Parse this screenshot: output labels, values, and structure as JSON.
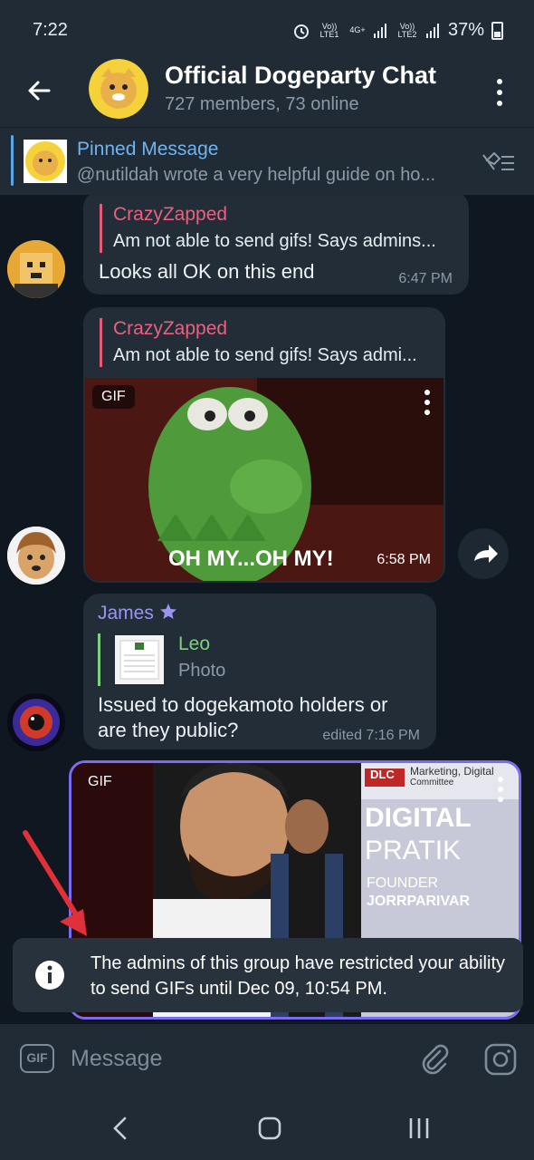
{
  "status": {
    "time": "7:22",
    "sim1": "Vo)) LTE1",
    "sim2": "Vo)) LTE2",
    "net": "4G+",
    "battery": "37%"
  },
  "header": {
    "title": "Official Dogeparty Chat",
    "subtitle": "727 members, 73 online"
  },
  "pinned": {
    "title": "Pinned Message",
    "text": "@nutildah wrote a very helpful guide on ho..."
  },
  "messages": [
    {
      "reply_name": "CrazyZapped",
      "reply_text": "Am not able to send gifs! Says admins...",
      "text": "Looks all OK on this end",
      "time": "6:47 PM"
    },
    {
      "reply_name": "CrazyZapped",
      "reply_text": "Am not able to send gifs! Says admi...",
      "gif_label": "GIF",
      "gif_caption": "OH MY...OH MY!",
      "time": "6:58 PM"
    },
    {
      "sender": "James",
      "reply_name": "Leo",
      "reply_text": "Photo",
      "text_line1": "Issued to dogekamoto holders or",
      "text_line2": "are they public?",
      "time": "edited 7:16 PM"
    },
    {
      "gif_label": "GIF",
      "banner_brand": "DLC",
      "banner_title": "Marketing, Digital",
      "banner_sub": "Committee",
      "banner_line1": "DIGITAL",
      "banner_line2": "PRATIK",
      "banner_line3": "FOUNDER",
      "banner_line4": "JORRPARIVAR"
    }
  ],
  "toast": {
    "text": "The admins of this group have restricted your ability to send GIFs until Dec 09, 10:54 PM."
  },
  "input": {
    "gif_button": "GIF",
    "placeholder": "Message"
  },
  "colors": {
    "accent": "#6fb4ef",
    "reply_name": "#e9617f",
    "leo": "#7fd17f",
    "james": "#9c93f0"
  },
  "icons": [
    "back-arrow-icon",
    "more-vertical-icon",
    "unpin-icon",
    "info-icon",
    "attach-icon",
    "instagram-camera-icon",
    "share-icon",
    "star-icon"
  ]
}
